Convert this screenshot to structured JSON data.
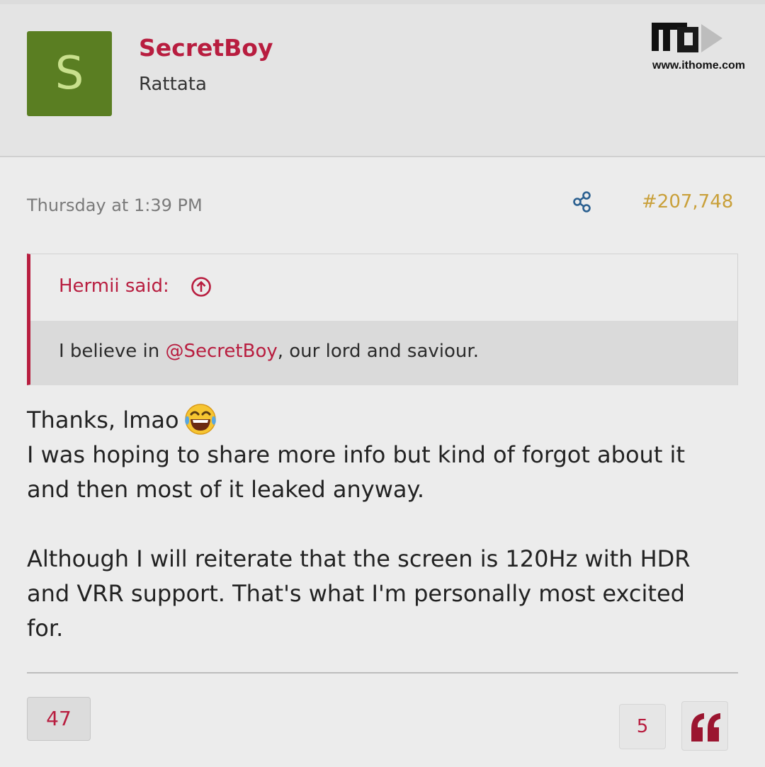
{
  "header": {
    "avatar_letter": "S",
    "username": "SecretBoy",
    "user_title": "Rattata"
  },
  "watermark": {
    "icon": "ithome-logo",
    "site": "www.ithome.com"
  },
  "post": {
    "date": "Thursday at 1:39 PM",
    "share_icon": "share-icon",
    "number": "#207,748",
    "quote": {
      "author": "Hermii said:",
      "arrow_icon": "arrow-up-circle-icon",
      "text_before": "I believe in ",
      "mention": "@SecretBoy",
      "text_after": ", our lord and saviour."
    },
    "body": {
      "line1": "Thanks, lmao",
      "emoji": "tears-of-joy-emoji",
      "line2": "I was hoping to share more info but kind of forgot about it and then most of it leaked anyway.",
      "paragraph2": "Although I will reiterate that the screen is 120Hz with HDR and VRR support. That's what I'm personally most excited for."
    }
  },
  "footer": {
    "likes": "47",
    "replies": "5",
    "quote_icon": "quote-icon"
  },
  "colors": {
    "accent": "#b81d3f",
    "post_number": "#c9a03a",
    "avatar_bg": "#5a7e22",
    "share_icon": "#2a5f8f"
  }
}
